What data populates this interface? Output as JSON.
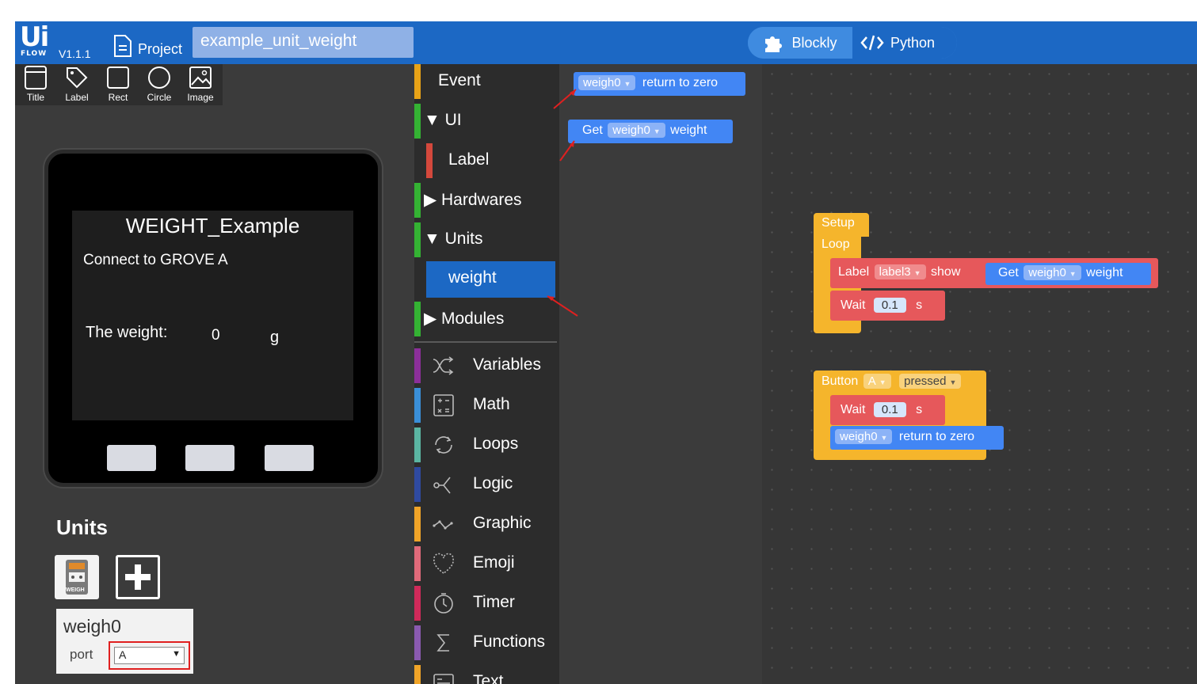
{
  "app": {
    "logo_text": "Ui",
    "logo_sub": "FLOW",
    "version": "V1.1.1",
    "project_label": "Project",
    "project_name": "example_unit_weight",
    "mode_blockly": "Blockly",
    "mode_python": "Python"
  },
  "tools": [
    {
      "label": "Title",
      "icon": "title-icon"
    },
    {
      "label": "Label",
      "icon": "label-icon"
    },
    {
      "label": "Rect",
      "icon": "rect-icon"
    },
    {
      "label": "Circle",
      "icon": "circle-icon"
    },
    {
      "label": "Image",
      "icon": "image-icon"
    }
  ],
  "screen": {
    "title": "WEIGHT_Example",
    "connect": "Connect to GROVE A",
    "weight_label": "The weight:",
    "weight_value": "0",
    "weight_unit": "g"
  },
  "units_panel": {
    "heading": "Units",
    "unit_icon_text": "WEIGH",
    "unit_name": "weigh0",
    "port_label": "port",
    "port_value": "A"
  },
  "toolbox": {
    "categories": [
      {
        "label": "Event",
        "color": "#e8a317"
      },
      {
        "label": "▼ UI",
        "color": "#34b233"
      },
      {
        "label": "Label",
        "color": "#d4483c"
      },
      {
        "label": "▶ Hardwares",
        "color": "#34b233"
      },
      {
        "label": "▼ Units",
        "color": "#34b233"
      },
      {
        "label": "weight",
        "color": "#1c68c4"
      },
      {
        "label": "▶ Modules",
        "color": "#34b233"
      },
      {
        "label": "Variables",
        "color": "#8c2f9a",
        "icon": "variables-icon"
      },
      {
        "label": "Math",
        "color": "#3a8fd8",
        "icon": "math-icon"
      },
      {
        "label": "Loops",
        "color": "#5bb5a2",
        "icon": "loops-icon"
      },
      {
        "label": "Logic",
        "color": "#2f4aa0",
        "icon": "logic-icon"
      },
      {
        "label": "Graphic",
        "color": "#f0a428",
        "icon": "graphic-icon"
      },
      {
        "label": "Emoji",
        "color": "#e06a7a",
        "icon": "emoji-icon"
      },
      {
        "label": "Timer",
        "color": "#d02a5a",
        "icon": "timer-icon"
      },
      {
        "label": "Functions",
        "color": "#8a5ab0",
        "icon": "functions-icon"
      },
      {
        "label": "Text",
        "color": "#f0a428",
        "icon": "text-icon"
      }
    ]
  },
  "flyout": {
    "block1": {
      "field": "weigh0",
      "text": "return to zero"
    },
    "block2": {
      "prefix": "Get",
      "field": "weigh0",
      "suffix": "weight"
    }
  },
  "workspace": {
    "setup": "Setup",
    "loop": "Loop",
    "label_block": {
      "prefix": "Label",
      "field": "label3",
      "verb": "show"
    },
    "get_block": {
      "prefix": "Get",
      "field": "weigh0",
      "suffix": "weight"
    },
    "wait1": {
      "prefix": "Wait",
      "value": "0.1",
      "unit": "s"
    },
    "button_block": {
      "prefix": "Button",
      "field": "A",
      "event": "pressed"
    },
    "wait2": {
      "prefix": "Wait",
      "value": "0.1",
      "unit": "s"
    },
    "zero_block": {
      "field": "weigh0",
      "text": "return to zero"
    }
  },
  "colors": {
    "topbar": "#1c68c4",
    "event_block": "#f5b52c",
    "ui_block": "#e6585b",
    "unit_block": "#4286f4",
    "annotation": "#e02020"
  }
}
